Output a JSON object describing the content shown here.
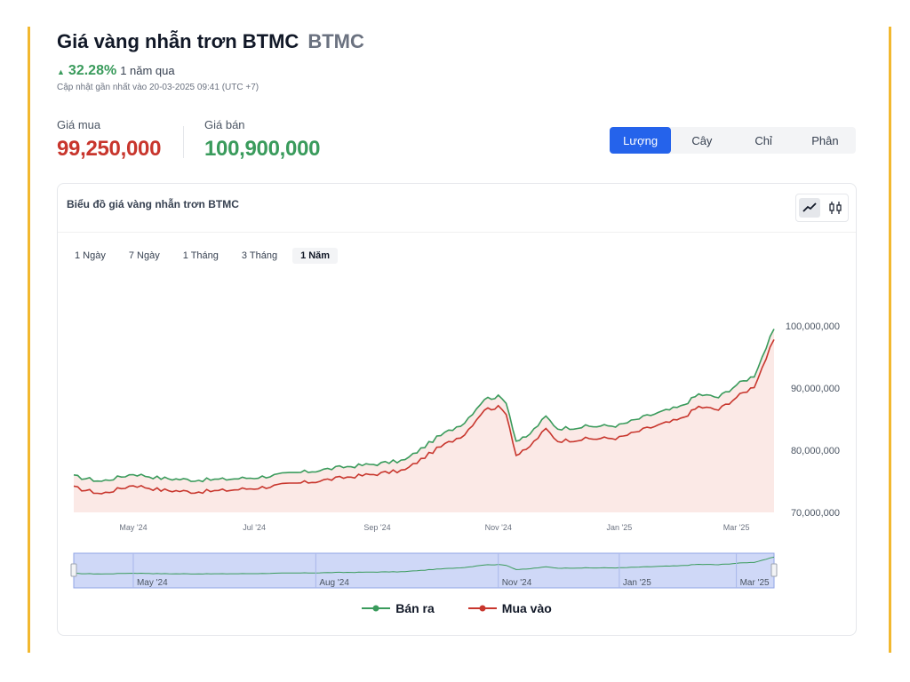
{
  "header": {
    "title": "Giá vàng nhẫn trơn BTMC",
    "code": "BTMC",
    "change_pct": "32.28%",
    "change_period": "1 năm qua",
    "updated": "Cập nhật gần nhất vào 20-03-2025 09:41 (UTC +7)"
  },
  "prices": {
    "buy_label": "Giá mua",
    "buy_value": "99,250,000",
    "sell_label": "Giá bán",
    "sell_value": "100,900,000"
  },
  "unit_tabs": [
    "Lượng",
    "Cây",
    "Chỉ",
    "Phân"
  ],
  "unit_active": 0,
  "card": {
    "title": "Biểu đồ giá vàng nhẫn trơn BTMC",
    "range_tabs": [
      "1 Ngày",
      "7 Ngày",
      "1 Tháng",
      "3 Tháng",
      "1 Năm"
    ],
    "range_active": 4
  },
  "colors": {
    "sell_line": "#3a9b5c",
    "buy_line": "#c8362d",
    "area": "#fbe9e6",
    "nav_bg": "#cfd8f7",
    "accent": "#2563eb",
    "rail": "#f2b82f"
  },
  "chart_data": {
    "type": "line",
    "x_type": "date",
    "x": [
      "2024-04-01",
      "2024-04-15",
      "2024-05-01",
      "2024-05-15",
      "2024-06-01",
      "2024-06-15",
      "2024-07-01",
      "2024-07-15",
      "2024-08-01",
      "2024-08-15",
      "2024-09-01",
      "2024-09-15",
      "2024-10-01",
      "2024-10-15",
      "2024-10-25",
      "2024-11-01",
      "2024-11-05",
      "2024-11-10",
      "2024-11-15",
      "2024-11-25",
      "2024-12-01",
      "2024-12-15",
      "2025-01-01",
      "2025-01-15",
      "2025-02-01",
      "2025-02-10",
      "2025-02-20",
      "2025-03-01",
      "2025-03-10",
      "2025-03-20"
    ],
    "series": [
      {
        "name": "Bán ra",
        "values": [
          75.8,
          75.0,
          76.2,
          75.5,
          75.2,
          75.3,
          75.6,
          76.1,
          76.7,
          77.3,
          77.8,
          78.4,
          82.0,
          84.5,
          88.3,
          88.6,
          87.8,
          81.5,
          82.0,
          85.4,
          83.5,
          83.8,
          84.0,
          85.5,
          87.0,
          89.0,
          88.5,
          90.5,
          92.0,
          99.5
        ]
      },
      {
        "name": "Mua vào",
        "values": [
          74.0,
          73.0,
          74.4,
          73.6,
          73.3,
          73.5,
          73.9,
          74.4,
          75.0,
          75.6,
          76.2,
          76.8,
          80.2,
          82.6,
          86.6,
          86.9,
          86.0,
          79.2,
          80.0,
          83.4,
          81.5,
          81.8,
          82.0,
          83.5,
          85.0,
          87.0,
          86.5,
          88.5,
          90.3,
          97.8
        ]
      }
    ],
    "x_ticks": [
      "May '24",
      "Jul '24",
      "Sep '24",
      "Nov '24",
      "Jan '25",
      "Mar '25"
    ],
    "y_ticks": [
      "70,000,000",
      "80,000,000",
      "90,000,000",
      "100,000,000"
    ],
    "navigator_ticks": [
      "May '24",
      "Aug '24",
      "Nov '24",
      "Jan '25",
      "Mar '25"
    ],
    "ylim": [
      70,
      100
    ],
    "y_unit_multiplier": 1000000,
    "grid": false,
    "legend_position": "bottom-center"
  }
}
